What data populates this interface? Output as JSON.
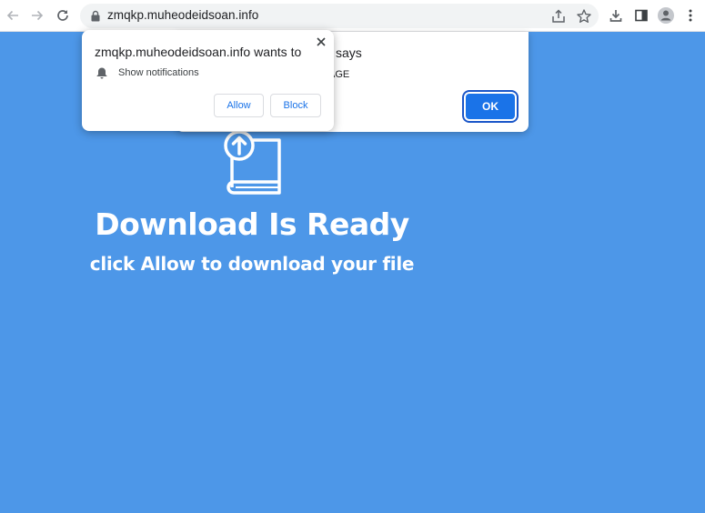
{
  "browser": {
    "url": "zmqkp.muheodeidsoan.info",
    "icons": [
      "back-icon",
      "forward-icon",
      "reload-icon",
      "lock-icon",
      "share-icon",
      "star-icon",
      "download-icon",
      "side-panel-icon",
      "profile-icon",
      "menu-icon"
    ]
  },
  "permission_prompt": {
    "title": "zmqkp.muheodeidsoan.info wants to",
    "permission": "Show notifications",
    "allow_label": "Allow",
    "block_label": "Block"
  },
  "alert_dialog": {
    "title_fragment": "says",
    "message_fragment": "AGE",
    "ok_label": "OK"
  },
  "page": {
    "headline": "Download Is Ready",
    "subline": "click Allow to download your file"
  },
  "colors": {
    "page_background": "#4d97e8",
    "accent": "#1a73e8"
  }
}
